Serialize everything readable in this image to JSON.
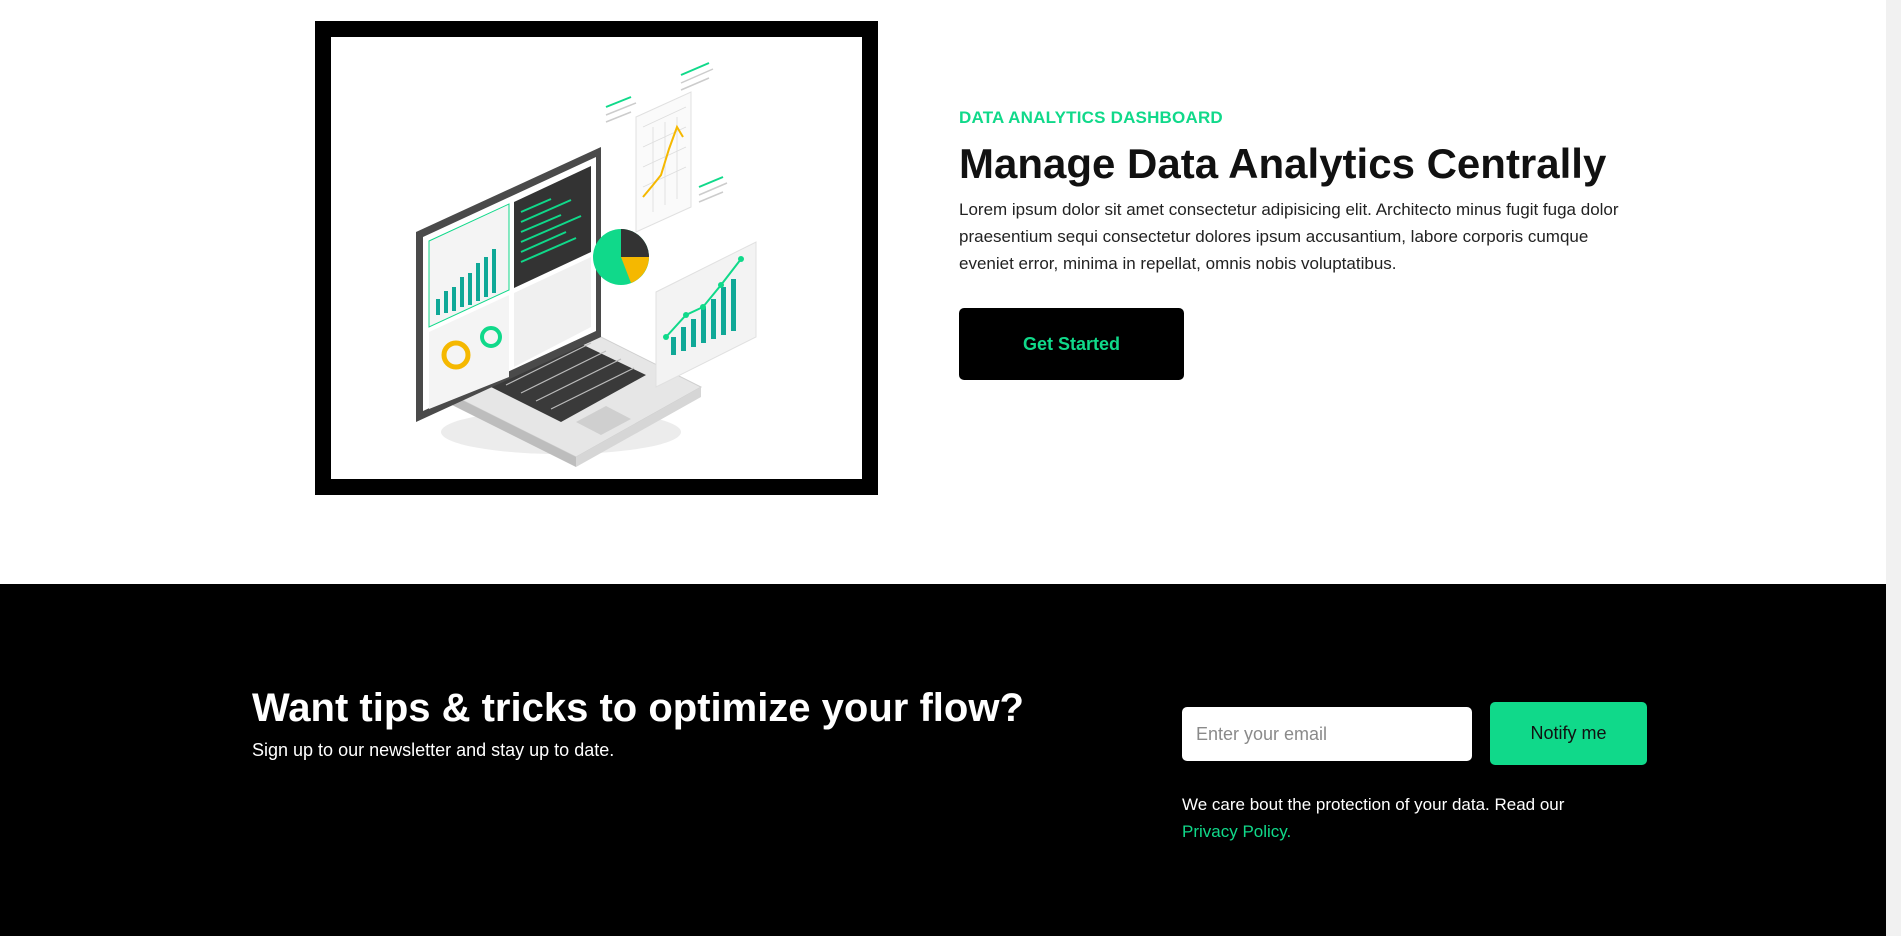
{
  "hero": {
    "eyebrow": "DATA ANALYTICS DASHBOARD",
    "title": "Manage Data Analytics Centrally",
    "description": "Lorem ipsum dolor sit amet consectetur adipisicing elit. Architecto minus fugit fuga dolor praesentium sequi consectetur dolores ipsum accusantium, labore corporis cumque eveniet error, minima in repellat, omnis nobis voluptatibus.",
    "cta_label": "Get Started",
    "illustration_icon": "analytics-laptop-illustration"
  },
  "newsletter": {
    "title": "Want tips & tricks to optimize your flow?",
    "subtitle": "Sign up to our newsletter and stay up to date.",
    "email_placeholder": "Enter your email",
    "button_label": "Notify me",
    "privacy_text": "We care bout the protection of your data. Read our",
    "privacy_link": "Privacy Policy."
  },
  "colors": {
    "accent": "#10d98a",
    "dark": "#000000",
    "background": "#ffffff"
  }
}
